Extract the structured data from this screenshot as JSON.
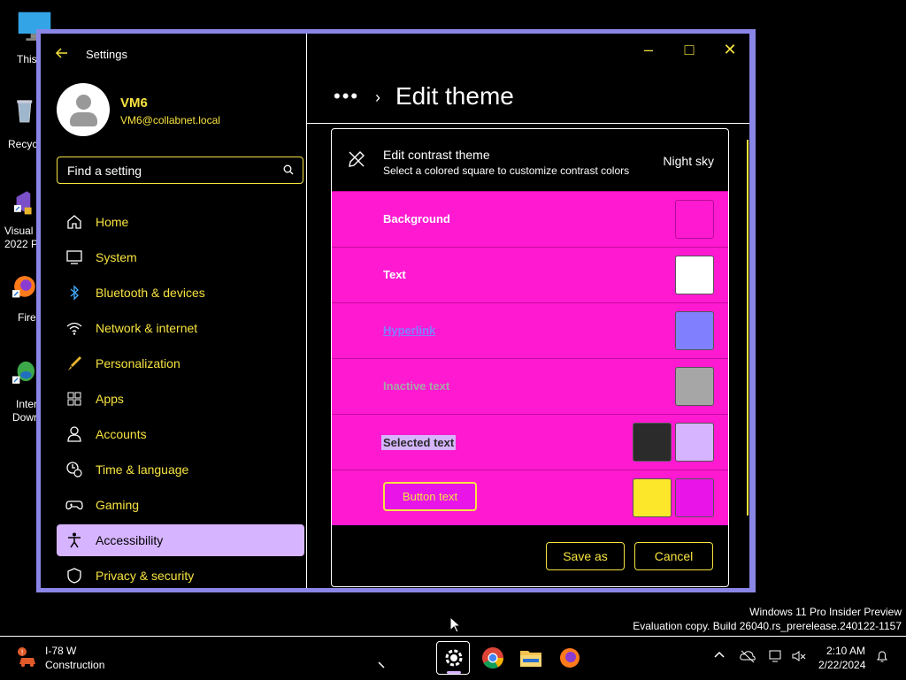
{
  "desktop": {
    "icons": [
      {
        "label": "This",
        "icon": "monitor-icon"
      },
      {
        "label": "Recycl",
        "icon": "recycle-bin-icon"
      },
      {
        "label": "Visual \n2022 P",
        "line1": "Visual",
        "line2": "2022 P",
        "icon": "visual-studio-icon"
      },
      {
        "label": "Fire",
        "icon": "firefox-icon"
      },
      {
        "label": "Inter Dowr",
        "line1": "Inter",
        "line2": "Dowr",
        "icon": "download-manager-icon"
      }
    ]
  },
  "window": {
    "app_title": "Settings",
    "controls": {
      "minimize": "–",
      "maximize": "□",
      "close": "✕"
    }
  },
  "user": {
    "name": "VM6",
    "email": "VM6@collabnet.local"
  },
  "search": {
    "placeholder": "Find a setting"
  },
  "nav": [
    {
      "label": "Home",
      "icon": "home-icon",
      "active": false
    },
    {
      "label": "System",
      "icon": "monitor-icon",
      "active": false
    },
    {
      "label": "Bluetooth & devices",
      "icon": "bluetooth-icon",
      "active": false
    },
    {
      "label": "Network & internet",
      "icon": "wifi-icon",
      "active": false
    },
    {
      "label": "Personalization",
      "icon": "brush-icon",
      "active": false
    },
    {
      "label": "Apps",
      "icon": "apps-icon",
      "active": false
    },
    {
      "label": "Accounts",
      "icon": "person-icon",
      "active": false
    },
    {
      "label": "Time & language",
      "icon": "clock-globe-icon",
      "active": false
    },
    {
      "label": "Gaming",
      "icon": "gamepad-icon",
      "active": false
    },
    {
      "label": "Accessibility",
      "icon": "accessibility-icon",
      "active": true
    },
    {
      "label": "Privacy & security",
      "icon": "shield-icon",
      "active": false
    }
  ],
  "breadcrumb": {
    "more": "•••",
    "separator": "›",
    "title": "Edit theme"
  },
  "panel": {
    "header": {
      "title": "Edit contrast theme",
      "subtitle": "Select a colored square to customize contrast colors",
      "theme_name": "Night sky"
    },
    "rows": [
      {
        "label": "Background",
        "label_color": "#ffffff",
        "swatches": [
          "#ff1ad1"
        ]
      },
      {
        "label": "Text",
        "label_color": "#ffffff",
        "swatches": [
          "#ffffff"
        ]
      },
      {
        "label": "Hyperlink",
        "label_color": "#8080ff",
        "swatches": [
          "#8080ff"
        ]
      },
      {
        "label": "Inactive text",
        "label_color": "#a6a6a6",
        "swatches": [
          "#a6a6a6"
        ]
      },
      {
        "label": "Selected text",
        "label_color": "#2b2b2b",
        "swatches": [
          "#2b2b2b",
          "#d6b4ff"
        ]
      },
      {
        "label": "Button text",
        "label_color": "#f7e340",
        "swatches": [
          "#fde72a",
          "#e814e8"
        ]
      }
    ],
    "buttons": {
      "save_as": "Save as",
      "cancel": "Cancel"
    }
  },
  "watermark": {
    "line1": "Windows 11 Pro Insider Preview",
    "line2": "Evaluation copy. Build 26040.rs_prerelease.240122-1157"
  },
  "taskbar": {
    "weather": {
      "line1": "I-78 W",
      "line2": "Construction"
    },
    "apps": [
      "settings-icon",
      "chrome-icon",
      "file-explorer-icon",
      "firefox-icon"
    ],
    "clock": {
      "time": "2:10 AM",
      "date": "2/22/2024"
    }
  },
  "colors": {
    "accent": "#f7e340",
    "panel_row_bg": "#ff1ad1",
    "active_nav": "#d6b4ff",
    "window_border": "#8a86e8"
  }
}
